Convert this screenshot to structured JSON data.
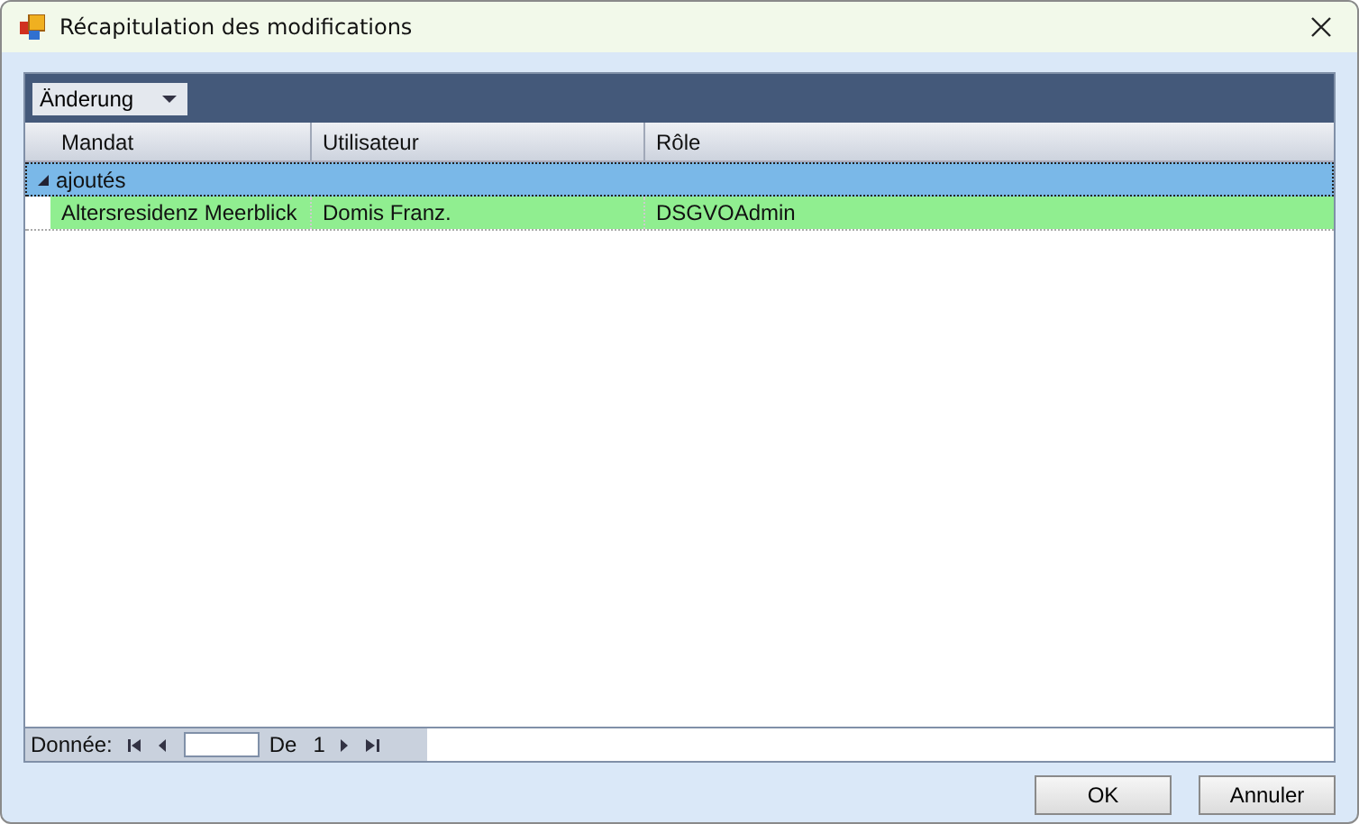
{
  "window": {
    "title": "Récapitulation des modifications"
  },
  "toolbar": {
    "dropdown": "Änderung"
  },
  "table": {
    "columns": [
      "Mandat",
      "Utilisateur",
      "Rôle"
    ],
    "groups": [
      {
        "label": "ajoutés",
        "expanded": true,
        "rows": [
          {
            "cells": [
              "Altersresidenz Meerblick",
              "Domis Franz.",
              "DSGVOAdmin"
            ],
            "selected": true
          }
        ]
      }
    ]
  },
  "navigator": {
    "label": "Donnée:",
    "of_label": "De",
    "total": "1"
  },
  "buttons": [
    "OK",
    "Annuler"
  ]
}
